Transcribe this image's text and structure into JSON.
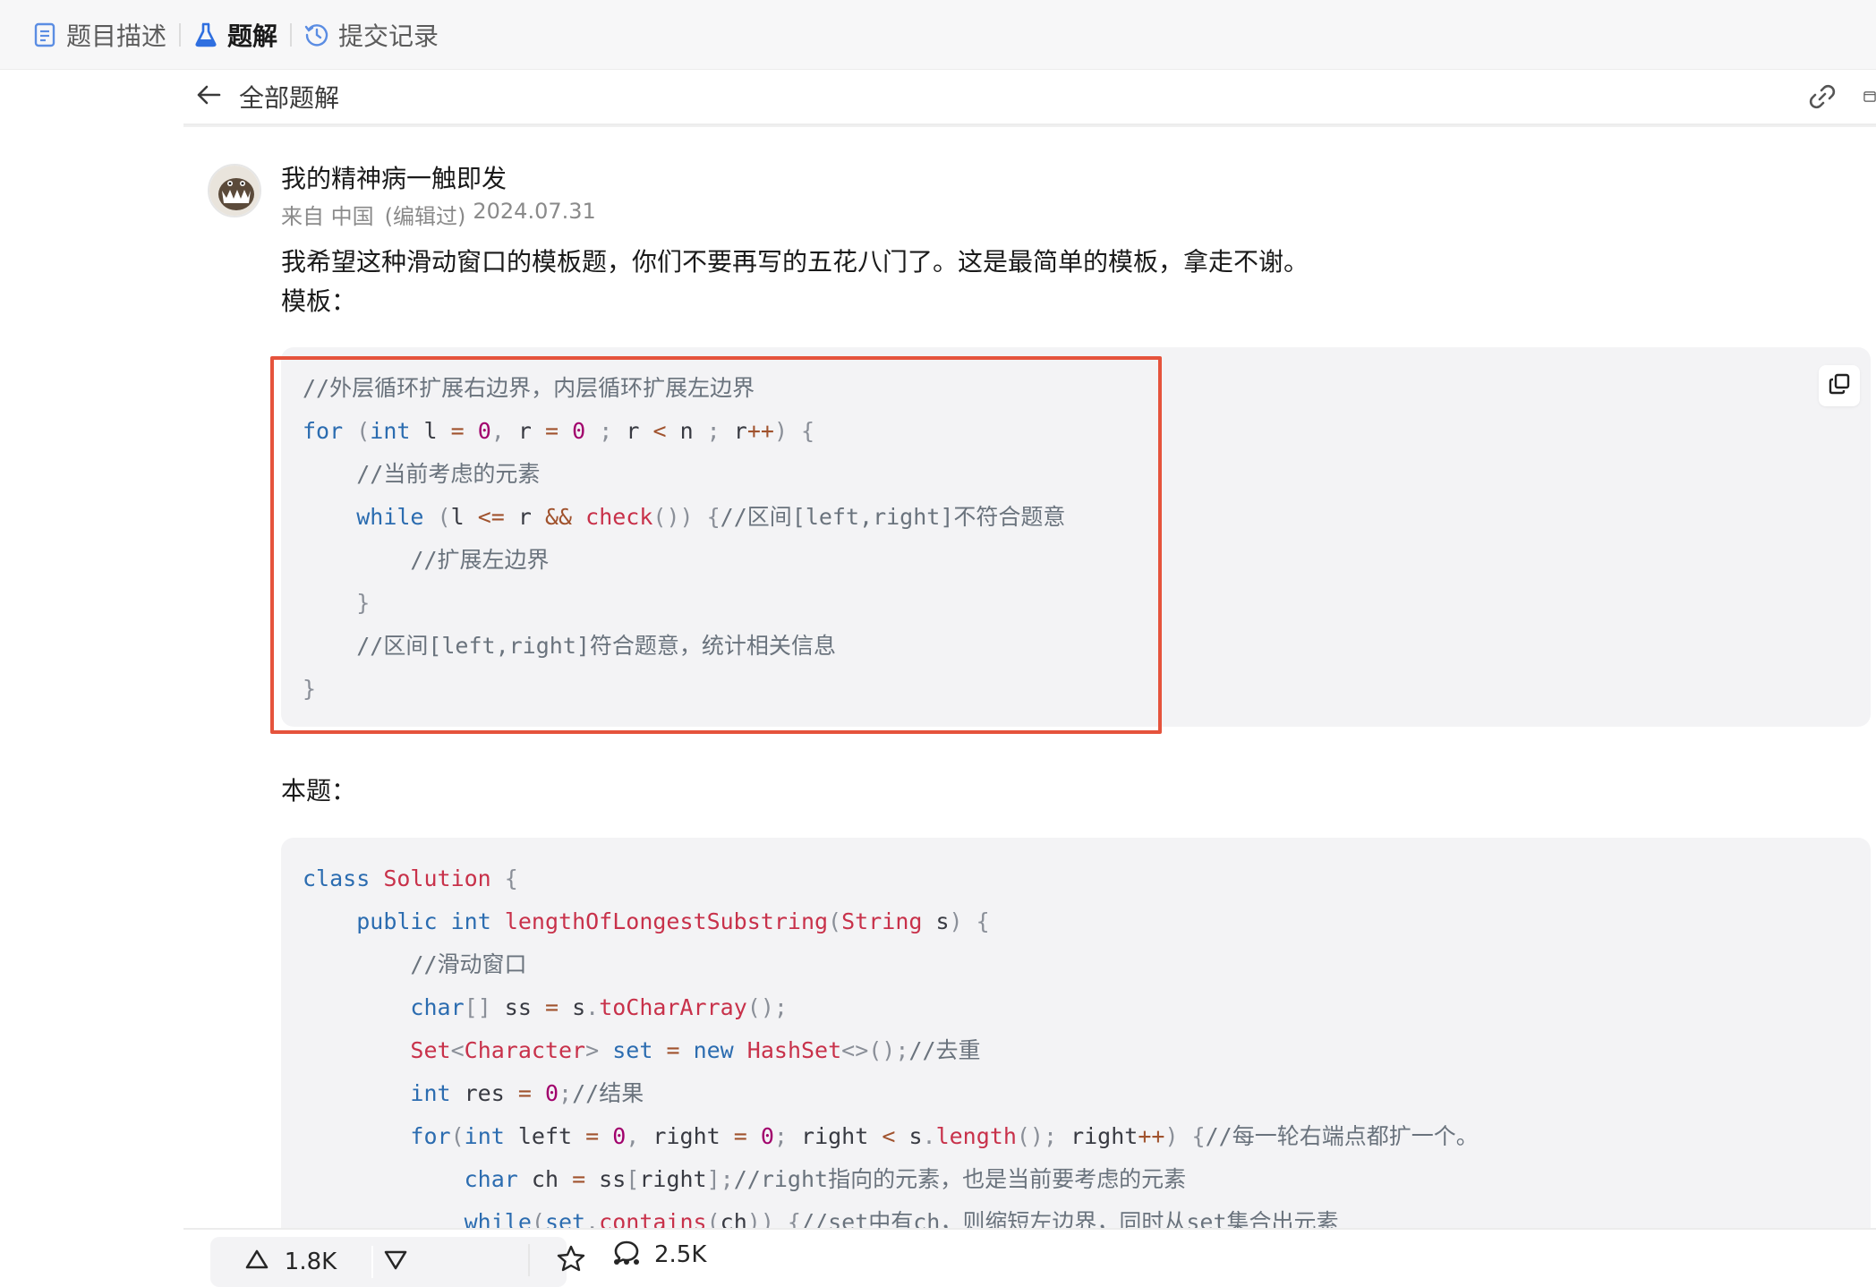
{
  "tabs": [
    {
      "label": "题目描述",
      "icon": "document-icon"
    },
    {
      "label": "题解",
      "icon": "flask-icon",
      "active": true
    },
    {
      "label": "提交记录",
      "icon": "history-icon"
    }
  ],
  "header": {
    "back_label": "全部题解"
  },
  "author": {
    "name": "我的精神病一触即发",
    "location": "来自 中国",
    "edited": "(编辑过)",
    "date": "2024.07.31"
  },
  "intro": {
    "line1": "我希望这种滑动窗口的模板题，你们不要再写的五花八门了。这是最简单的模板，拿走不谢。",
    "line2": "模板："
  },
  "section_label": "本题：",
  "code1": [
    [
      [
        "cm",
        "//外层循环扩展右边界，内层循环扩展左边界"
      ]
    ],
    [
      [
        "kw",
        "for"
      ],
      [
        "pn",
        " ("
      ],
      [
        "kw",
        "int"
      ],
      [
        "t",
        " l "
      ],
      [
        "op",
        "="
      ],
      [
        "t",
        " "
      ],
      [
        "num",
        "0"
      ],
      [
        "pn",
        ","
      ],
      [
        "t",
        " r "
      ],
      [
        "op",
        "="
      ],
      [
        "t",
        " "
      ],
      [
        "num",
        "0"
      ],
      [
        "t",
        " "
      ],
      [
        "pn",
        ";"
      ],
      [
        "t",
        " r "
      ],
      [
        "op",
        "<"
      ],
      [
        "t",
        " n "
      ],
      [
        "pn",
        ";"
      ],
      [
        "t",
        " r"
      ],
      [
        "op",
        "++"
      ],
      [
        "pn",
        ") {"
      ]
    ],
    [
      [
        "t",
        "    "
      ],
      [
        "cm",
        "//当前考虑的元素"
      ]
    ],
    [
      [
        "t",
        "    "
      ],
      [
        "kw",
        "while"
      ],
      [
        "pn",
        " ("
      ],
      [
        "t",
        "l "
      ],
      [
        "op",
        "<="
      ],
      [
        "t",
        " r "
      ],
      [
        "op",
        "&&"
      ],
      [
        "t",
        " "
      ],
      [
        "fn",
        "check"
      ],
      [
        "pn",
        "()) {"
      ],
      [
        "cm",
        "//区间[left,right]不符合题意"
      ]
    ],
    [
      [
        "t",
        "        "
      ],
      [
        "cm",
        "//扩展左边界"
      ]
    ],
    [
      [
        "t",
        "    "
      ],
      [
        "pn",
        "}"
      ]
    ],
    [
      [
        "t",
        "    "
      ],
      [
        "cm",
        "//区间[left,right]符合题意，统计相关信息"
      ]
    ],
    [
      [
        "pn",
        "}"
      ]
    ]
  ],
  "code2": [
    [
      [
        "kw",
        "class"
      ],
      [
        "t",
        " "
      ],
      [
        "fn",
        "Solution"
      ],
      [
        "pn",
        " {"
      ]
    ],
    [
      [
        "t",
        "    "
      ],
      [
        "kw",
        "public"
      ],
      [
        "t",
        " "
      ],
      [
        "kw",
        "int"
      ],
      [
        "t",
        " "
      ],
      [
        "fn",
        "lengthOfLongestSubstring"
      ],
      [
        "pn",
        "("
      ],
      [
        "fn",
        "String"
      ],
      [
        "t",
        " s"
      ],
      [
        "pn",
        ") {"
      ]
    ],
    [
      [
        "t",
        "        "
      ],
      [
        "cm",
        "//滑动窗口"
      ]
    ],
    [
      [
        "t",
        "        "
      ],
      [
        "kw",
        "char"
      ],
      [
        "pn",
        "[]"
      ],
      [
        "t",
        " ss "
      ],
      [
        "op",
        "="
      ],
      [
        "t",
        " s"
      ],
      [
        "pn",
        "."
      ],
      [
        "fn",
        "toCharArray"
      ],
      [
        "pn",
        "();"
      ]
    ],
    [
      [
        "t",
        "        "
      ],
      [
        "fn",
        "Set"
      ],
      [
        "pn",
        "<"
      ],
      [
        "fn",
        "Character"
      ],
      [
        "pn",
        ">"
      ],
      [
        "t",
        " "
      ],
      [
        "kw",
        "set"
      ],
      [
        "t",
        " "
      ],
      [
        "op",
        "="
      ],
      [
        "t",
        " "
      ],
      [
        "kw",
        "new"
      ],
      [
        "t",
        " "
      ],
      [
        "fn",
        "HashSet"
      ],
      [
        "pn",
        "<>();"
      ],
      [
        "cm",
        "//去重"
      ]
    ],
    [
      [
        "t",
        "        "
      ],
      [
        "kw",
        "int"
      ],
      [
        "t",
        " res "
      ],
      [
        "op",
        "="
      ],
      [
        "t",
        " "
      ],
      [
        "num",
        "0"
      ],
      [
        "pn",
        ";"
      ],
      [
        "cm",
        "//结果"
      ]
    ],
    [
      [
        "t",
        "        "
      ],
      [
        "kw",
        "for"
      ],
      [
        "pn",
        "("
      ],
      [
        "kw",
        "int"
      ],
      [
        "t",
        " left "
      ],
      [
        "op",
        "="
      ],
      [
        "t",
        " "
      ],
      [
        "num",
        "0"
      ],
      [
        "pn",
        ","
      ],
      [
        "t",
        " right "
      ],
      [
        "op",
        "="
      ],
      [
        "t",
        " "
      ],
      [
        "num",
        "0"
      ],
      [
        "pn",
        ";"
      ],
      [
        "t",
        " right "
      ],
      [
        "op",
        "<"
      ],
      [
        "t",
        " s"
      ],
      [
        "pn",
        "."
      ],
      [
        "fn",
        "length"
      ],
      [
        "pn",
        "();"
      ],
      [
        "t",
        " right"
      ],
      [
        "op",
        "++"
      ],
      [
        "pn",
        ") {"
      ],
      [
        "cm",
        "//每一轮右端点都扩一个。"
      ]
    ],
    [
      [
        "t",
        "            "
      ],
      [
        "kw",
        "char"
      ],
      [
        "t",
        " ch "
      ],
      [
        "op",
        "="
      ],
      [
        "t",
        " ss"
      ],
      [
        "pn",
        "["
      ],
      [
        "t",
        "right"
      ],
      [
        "pn",
        "];"
      ],
      [
        "cm",
        "//right指向的元素，也是当前要考虑的元素"
      ]
    ],
    [
      [
        "t",
        "            "
      ],
      [
        "kw",
        "while"
      ],
      [
        "pn",
        "("
      ],
      [
        "kw",
        "set"
      ],
      [
        "pn",
        "."
      ],
      [
        "fn",
        "contains"
      ],
      [
        "pn",
        "("
      ],
      [
        "t",
        "ch"
      ],
      [
        "pn",
        ")) {"
      ],
      [
        "cm",
        "//set中有ch，则缩短左边界，同时从set集合出元素"
      ]
    ]
  ],
  "footer": {
    "upvotes": "1.8K",
    "comments": "2.5K"
  },
  "colors": {
    "accent_red": "#e5533c",
    "code_bg": "#f3f3f5",
    "keyword": "#2b6cb0",
    "function": "#c8314a",
    "number": "#a1006c"
  }
}
